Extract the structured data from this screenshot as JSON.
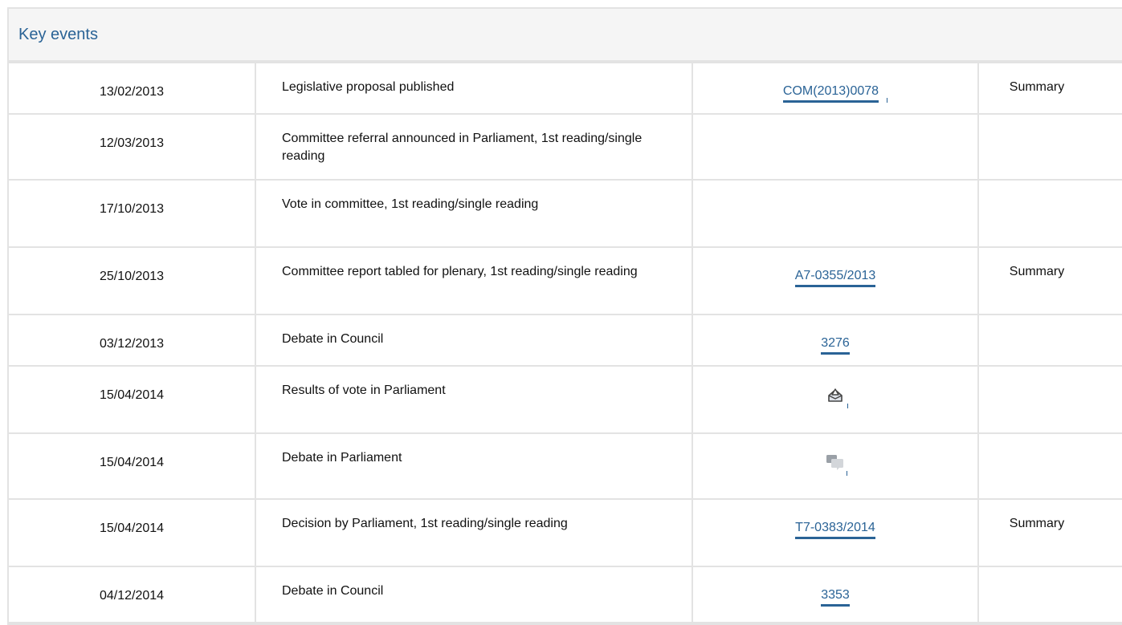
{
  "panel": {
    "title": "Key events"
  },
  "events": [
    {
      "date": "13/02/2013",
      "event": "Legislative proposal published",
      "doc": "COM(2013)0078",
      "summary": "Summary"
    },
    {
      "date": "12/03/2013",
      "event": "Committee referral announced in Parliament, 1st reading/single reading",
      "doc": "",
      "summary": ""
    },
    {
      "date": "17/10/2013",
      "event": "Vote in committee, 1st reading/single reading",
      "doc": "",
      "summary": ""
    },
    {
      "date": "25/10/2013",
      "event": "Committee report tabled for plenary, 1st reading/single reading",
      "doc": "A7-0355/2013",
      "summary": "Summary"
    },
    {
      "date": "03/12/2013",
      "event": "Debate in Council",
      "doc": "3276",
      "summary": ""
    },
    {
      "date": "15/04/2014",
      "event": "Results of vote in Parliament",
      "doc_icon": "ballot-box-icon",
      "summary": ""
    },
    {
      "date": "15/04/2014",
      "event": "Debate in Parliament",
      "doc_icon": "speech-bubbles-icon",
      "summary": ""
    },
    {
      "date": "15/04/2014",
      "event": "Decision by Parliament, 1st reading/single reading",
      "doc": "T7-0383/2014",
      "summary": "Summary"
    },
    {
      "date": "04/12/2014",
      "event": "Debate in Council",
      "doc": "3353",
      "summary": ""
    }
  ],
  "colors": {
    "link": "#2a6396",
    "border": "#e3e3e3",
    "header_bg": "#f5f5f5"
  }
}
